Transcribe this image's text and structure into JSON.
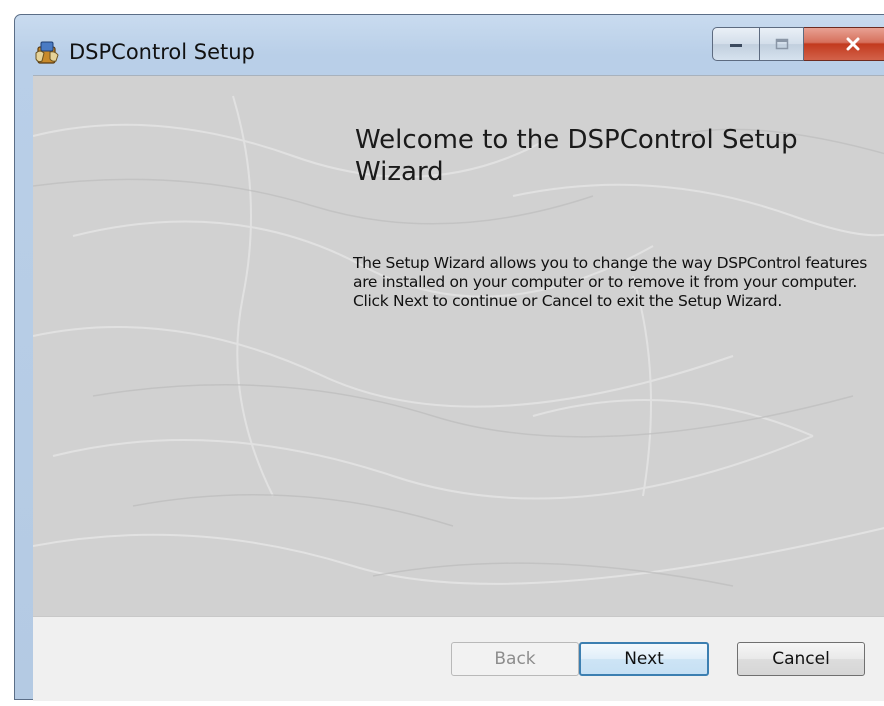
{
  "window": {
    "title": "DSPControl Setup",
    "caption_buttons": [
      "minimize",
      "maximize",
      "close"
    ]
  },
  "main": {
    "heading": "Welcome to the DSPControl Setup Wizard",
    "description": "The Setup Wizard allows you to change the way DSPControl features are installed on your computer or to remove it from your computer. Click Next to continue or Cancel to exit the Setup Wizard."
  },
  "footer": {
    "back_label": "Back",
    "next_label": "Next",
    "cancel_label": "Cancel",
    "back_enabled": false
  },
  "colors": {
    "panel_gray": "#d2d2d2",
    "frame_blue": "#b9cfe8",
    "close_red": "#c23a1e",
    "focus_blue": "#3c7fb1"
  },
  "icons": {
    "app": "installer-package-icon",
    "minimize": "minimize-icon",
    "maximize": "maximize-icon",
    "close": "close-icon"
  }
}
